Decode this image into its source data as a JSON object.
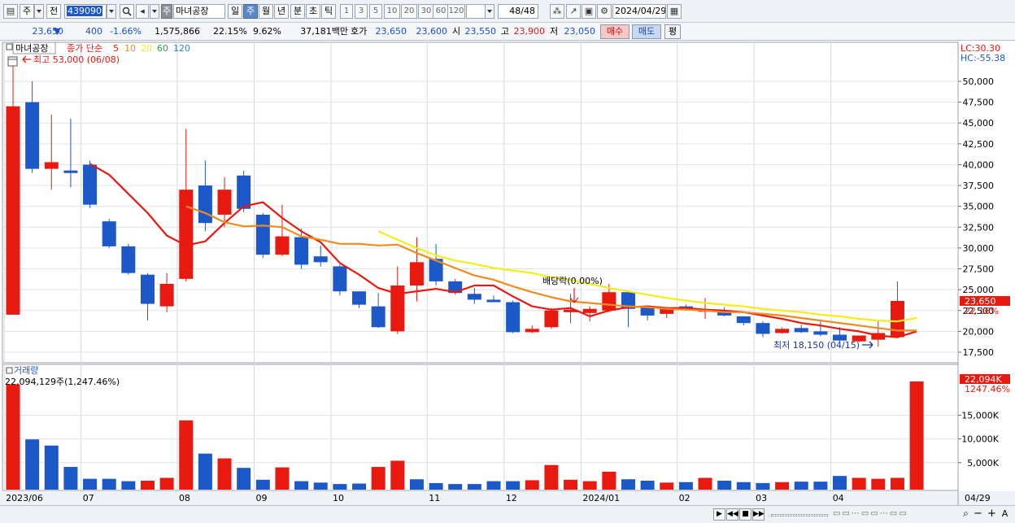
{
  "toolbar": {
    "period_type": "주",
    "compare_label": "전",
    "code": "439090",
    "market_badge": "주",
    "stock_name": "마녀공장",
    "periods": [
      "일",
      "주",
      "월",
      "년",
      "분",
      "초",
      "틱"
    ],
    "active_period": 1,
    "intervals": [
      "1",
      "3",
      "5",
      "10",
      "20",
      "30",
      "60",
      "120"
    ],
    "count": "48/48",
    "date": "2024/04/29"
  },
  "quote": {
    "price": "23,650",
    "change": "400",
    "change_pct": "-1.66%",
    "volume": "1,575,866",
    "turnover_pct": "22.15%",
    "rate2": "9.62%",
    "amount": "37,181백만",
    "hoga_label": "호가",
    "ask": "23,650",
    "bid": "23,600",
    "open_label": "시",
    "open": "23,550",
    "high_label": "고",
    "high": "23,900",
    "low_label": "저",
    "low": "23,050",
    "buy_label": "매수",
    "sell_label": "매도",
    "avg_label": "평"
  },
  "colors": {
    "up": "#e8190f",
    "down": "#1d58c8",
    "ma5": "#e8190f",
    "ma10": "#f08b1e",
    "ma20": "#f2ee1a",
    "ma60": "#2c9f45",
    "ma120": "#2f7fd6"
  },
  "chart_data": [
    {
      "type": "candlestick",
      "title": "마녀공장",
      "legend": {
        "label": "종가 단순",
        "ma_periods": [
          "5",
          "10",
          "20",
          "60",
          "120"
        ]
      },
      "y_ticks": [
        "50,000",
        "47,500",
        "45,000",
        "42,500",
        "40,000",
        "37,500",
        "35,000",
        "32,500",
        "30,000",
        "27,500",
        "25,000",
        "22,500",
        "20,000",
        "17,500"
      ],
      "y_range": [
        16500,
        54000
      ],
      "x_labels": [
        {
          "i": 0,
          "label": "2023/06"
        },
        {
          "i": 4,
          "label": "07"
        },
        {
          "i": 9,
          "label": "08"
        },
        {
          "i": 13,
          "label": "09"
        },
        {
          "i": 17,
          "label": "10"
        },
        {
          "i": 22,
          "label": "11"
        },
        {
          "i": 26,
          "label": "12"
        },
        {
          "i": 30,
          "label": "2024/01"
        },
        {
          "i": 35,
          "label": "02"
        },
        {
          "i": 39,
          "label": "03"
        },
        {
          "i": 43,
          "label": "04"
        }
      ],
      "last_x_label": "04/29",
      "candles": [
        {
          "o": 22000,
          "h": 53000,
          "l": 22000,
          "c": 47000
        },
        {
          "o": 47500,
          "h": 50000,
          "l": 39000,
          "c": 39500
        },
        {
          "o": 39500,
          "h": 46000,
          "l": 37000,
          "c": 40300
        },
        {
          "o": 39300,
          "h": 45500,
          "l": 37300,
          "c": 39000
        },
        {
          "o": 40000,
          "h": 40500,
          "l": 34800,
          "c": 35200
        },
        {
          "o": 33200,
          "h": 33500,
          "l": 30000,
          "c": 30200
        },
        {
          "o": 30200,
          "h": 30500,
          "l": 26800,
          "c": 27000
        },
        {
          "o": 26800,
          "h": 27000,
          "l": 21300,
          "c": 23300
        },
        {
          "o": 23000,
          "h": 27000,
          "l": 22300,
          "c": 25700
        },
        {
          "o": 26300,
          "h": 44300,
          "l": 26000,
          "c": 37000
        },
        {
          "o": 37500,
          "h": 40500,
          "l": 32000,
          "c": 33000
        },
        {
          "o": 34000,
          "h": 38500,
          "l": 32500,
          "c": 37000
        },
        {
          "o": 38700,
          "h": 39300,
          "l": 34300,
          "c": 34700
        },
        {
          "o": 34000,
          "h": 34200,
          "l": 28800,
          "c": 29200
        },
        {
          "o": 29200,
          "h": 35200,
          "l": 29000,
          "c": 31400
        },
        {
          "o": 31300,
          "h": 32300,
          "l": 27500,
          "c": 28000
        },
        {
          "o": 29000,
          "h": 30300,
          "l": 27800,
          "c": 28300
        },
        {
          "o": 27800,
          "h": 28000,
          "l": 24300,
          "c": 24800
        },
        {
          "o": 24800,
          "h": 24800,
          "l": 22800,
          "c": 23200
        },
        {
          "o": 23000,
          "h": 24600,
          "l": 20400,
          "c": 20500
        },
        {
          "o": 20000,
          "h": 27800,
          "l": 19700,
          "c": 25500
        },
        {
          "o": 25500,
          "h": 31300,
          "l": 23600,
          "c": 28300
        },
        {
          "o": 28700,
          "h": 30500,
          "l": 25500,
          "c": 26000
        },
        {
          "o": 26000,
          "h": 26300,
          "l": 24400,
          "c": 24600
        },
        {
          "o": 24500,
          "h": 25200,
          "l": 23300,
          "c": 23800
        },
        {
          "o": 23800,
          "h": 24300,
          "l": 23500,
          "c": 23500
        },
        {
          "o": 23500,
          "h": 23700,
          "l": 19800,
          "c": 19900
        },
        {
          "o": 19900,
          "h": 20700,
          "l": 19800,
          "c": 20300
        },
        {
          "o": 20500,
          "h": 22800,
          "l": 20300,
          "c": 22500
        },
        {
          "o": 22300,
          "h": 24500,
          "l": 21000,
          "c": 22600
        },
        {
          "o": 22200,
          "h": 23000,
          "l": 21200,
          "c": 22700
        },
        {
          "o": 22500,
          "h": 25700,
          "l": 22300,
          "c": 24700
        },
        {
          "o": 24700,
          "h": 24900,
          "l": 20500,
          "c": 22700
        },
        {
          "o": 23000,
          "h": 23100,
          "l": 21300,
          "c": 21900
        },
        {
          "o": 22100,
          "h": 22900,
          "l": 21600,
          "c": 22800
        },
        {
          "o": 23000,
          "h": 23200,
          "l": 22500,
          "c": 22600
        },
        {
          "o": 22500,
          "h": 24000,
          "l": 21500,
          "c": 22500
        },
        {
          "o": 22500,
          "h": 22900,
          "l": 21800,
          "c": 21900
        },
        {
          "o": 21800,
          "h": 21800,
          "l": 20700,
          "c": 21000
        },
        {
          "o": 21000,
          "h": 21200,
          "l": 19300,
          "c": 19700
        },
        {
          "o": 19800,
          "h": 20500,
          "l": 19700,
          "c": 20300
        },
        {
          "o": 20400,
          "h": 20800,
          "l": 19800,
          "c": 19900
        },
        {
          "o": 20000,
          "h": 21300,
          "l": 19400,
          "c": 19600
        },
        {
          "o": 19600,
          "h": 20500,
          "l": 18800,
          "c": 18900
        },
        {
          "o": 18800,
          "h": 19400,
          "l": 18700,
          "c": 19500
        },
        {
          "o": 19000,
          "h": 21300,
          "l": 18150,
          "c": 19800
        },
        {
          "o": 19300,
          "h": 26000,
          "l": 19200,
          "c": 23650
        }
      ],
      "moving_averages": [
        {
          "name": "5",
          "values": [
            null,
            null,
            null,
            null,
            40100,
            38800,
            36500,
            34200,
            31500,
            30300,
            30800,
            33000,
            35000,
            35500,
            33600,
            32000,
            30700,
            28200,
            26800,
            25200,
            24500,
            24800,
            25100,
            24700,
            25500,
            25500,
            24200,
            23000,
            22600,
            22800,
            21800,
            22500,
            22900,
            23000,
            22800,
            22800,
            22600,
            22500,
            22300,
            21900,
            21500,
            21000,
            20700,
            20300,
            20000,
            19500,
            19300,
            20000
          ]
        },
        {
          "name": "10",
          "values": [
            null,
            null,
            null,
            null,
            null,
            null,
            null,
            null,
            null,
            35000,
            34200,
            33100,
            32600,
            32700,
            32500,
            31400,
            31000,
            30500,
            30500,
            30300,
            30400,
            29400,
            28500,
            27600,
            26700,
            26200,
            25400,
            24700,
            24100,
            23600,
            23400,
            23200,
            23000,
            22900,
            22700,
            22600,
            22500,
            22300,
            22300,
            22100,
            21900,
            21600,
            21300,
            21000,
            20700,
            20400,
            20100,
            20100
          ]
        },
        {
          "name": "20",
          "values": [
            null,
            null,
            null,
            null,
            null,
            null,
            null,
            null,
            null,
            null,
            null,
            null,
            null,
            null,
            null,
            null,
            null,
            null,
            null,
            32000,
            31000,
            30000,
            29100,
            28500,
            28100,
            27600,
            27300,
            27000,
            26500,
            26200,
            25700,
            25200,
            24800,
            24400,
            24000,
            23700,
            23400,
            23200,
            23000,
            22700,
            22500,
            22300,
            22000,
            21800,
            21500,
            21300,
            21200,
            21600
          ]
        }
      ],
      "annotations": {
        "high_label": "최고 53,000 (06/08)",
        "low_label": "최저 18,150 (04/15)",
        "dividend_label": "배당락(0.00%)",
        "lc_label": "LC:30.30",
        "hc_label": "HC:-55.38",
        "last_price": "23,650",
        "last_pct": "22.16%"
      }
    },
    {
      "type": "bar",
      "title": "거래량",
      "summary": "22,094,129주(1,247.46%)",
      "y_ticks": [
        "15,000K",
        "10,000K",
        "5,000K"
      ],
      "y_range": [
        0,
        22094
      ],
      "last_value": "22,094K",
      "last_pct": "1247.46%",
      "values": [
        21500,
        9900,
        8600,
        4100,
        1600,
        1600,
        1100,
        1200,
        1800,
        13900,
        6900,
        5900,
        3900,
        1400,
        4000,
        1100,
        800,
        500,
        600,
        4100,
        5400,
        1500,
        700,
        500,
        500,
        1100,
        1100,
        1300,
        4500,
        1400,
        1100,
        3100,
        1500,
        1200,
        800,
        900,
        1800,
        1200,
        900,
        700,
        900,
        1000,
        1000,
        2200,
        1800,
        1600,
        1800,
        22094
      ],
      "up": [
        true,
        false,
        false,
        false,
        false,
        false,
        false,
        true,
        true,
        true,
        false,
        true,
        false,
        false,
        true,
        false,
        false,
        false,
        false,
        true,
        true,
        false,
        false,
        false,
        false,
        false,
        false,
        true,
        true,
        true,
        true,
        true,
        false,
        false,
        true,
        false,
        true,
        false,
        false,
        false,
        true,
        false,
        false,
        false,
        true,
        true,
        true,
        true
      ]
    }
  ]
}
